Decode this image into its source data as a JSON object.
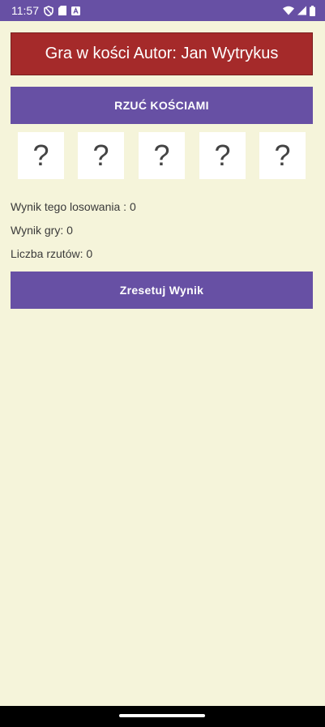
{
  "status_bar": {
    "time": "11:57",
    "icons_left": [
      "shield-icon",
      "sd-card-icon",
      "text-notification-icon"
    ],
    "icons_right": [
      "wifi-icon",
      "cell-signal-icon",
      "battery-icon"
    ]
  },
  "app": {
    "title": "Gra w kości Autor: Jan Wytrykus",
    "roll_button_label": "RZUĆ KOŚCIAMI",
    "dice": [
      "?",
      "?",
      "?",
      "?",
      "?"
    ],
    "draw_score": "Wynik tego losowania : 0",
    "game_score": "Wynik gry: 0",
    "roll_count": "Liczba rzutów: 0",
    "reset_button_label": "Zresetuj Wynik"
  },
  "colors": {
    "status_bar": "#6750a4",
    "background": "#f5f4da",
    "title_banner": "#a52a2a",
    "button": "#6750a4",
    "die_face": "#ffffff"
  }
}
